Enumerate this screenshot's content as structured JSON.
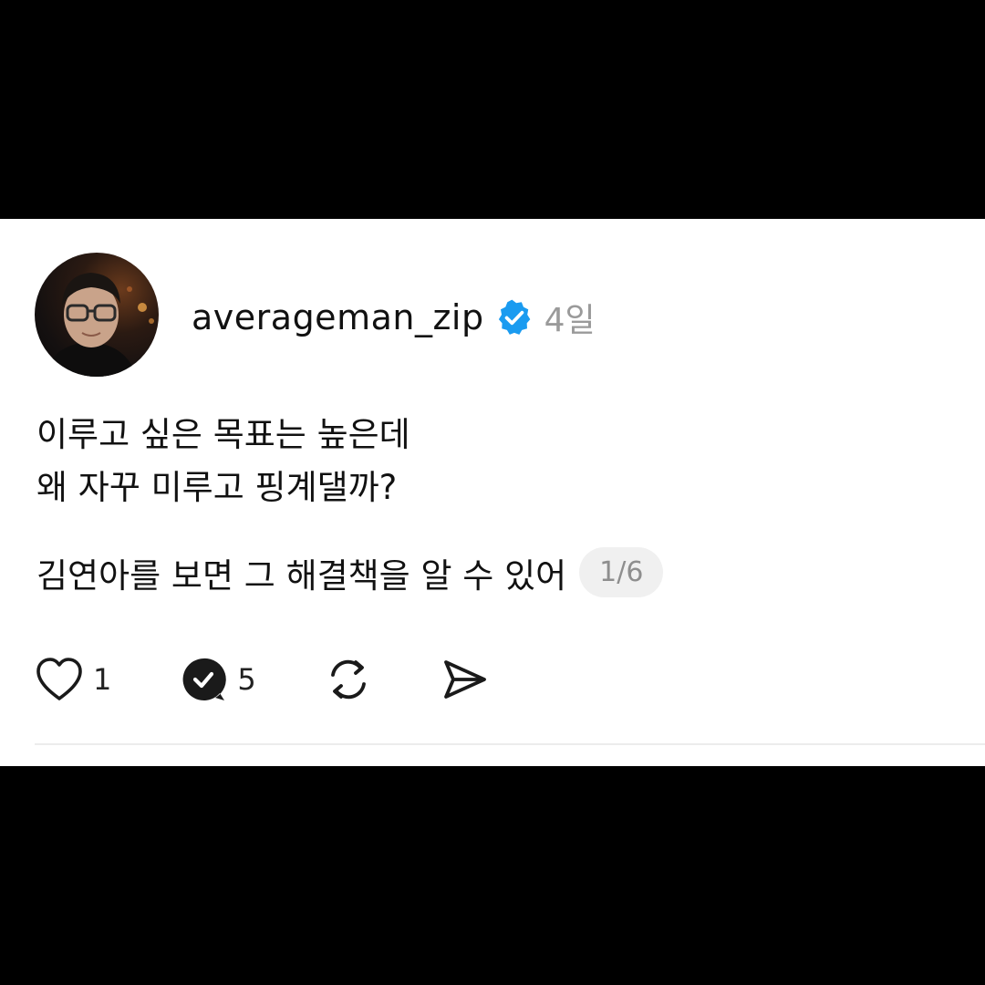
{
  "post": {
    "username": "averageman_zip",
    "time": "4일",
    "text_line1": "이루고 싶은 목표는 높은데",
    "text_line2": "왜 자꾸 미루고 핑계댈까?",
    "text_line3": "김연아를 보면 그 해결책을 알 수 있어",
    "page_indicator": "1/6"
  },
  "actions": {
    "like_count": "1",
    "reply_count": "5"
  },
  "icons": {
    "verified": "verified-badge-icon",
    "like": "heart-icon",
    "reply": "reply-bubble-icon",
    "repost": "repost-icon",
    "share": "send-icon"
  },
  "colors": {
    "verified_blue": "#1a9bf0",
    "text": "#111111",
    "muted": "#9a9a9a",
    "background_outer": "#000000",
    "card": "#ffffff"
  }
}
